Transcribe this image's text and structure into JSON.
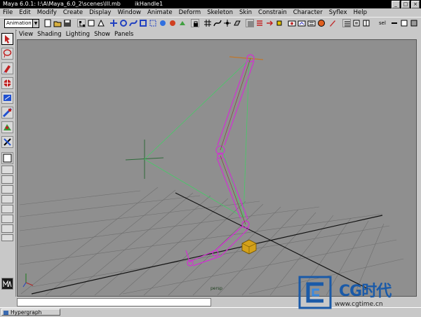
{
  "window": {
    "title": "Maya 6.0.1: I:\\A\\Maya_6.0_2\\scenes\\lll.mb",
    "title_object": "ikHandle1",
    "buttons": [
      "_",
      "□",
      "×"
    ]
  },
  "menus": [
    "File",
    "Edit",
    "Modify",
    "Create",
    "Display",
    "Window",
    "Animate",
    "Deform",
    "Skeleton",
    "Skin",
    "Constrain",
    "Character",
    "Syflex",
    "Help"
  ],
  "status_line": {
    "mode": "Animation",
    "select_label": "sel"
  },
  "panel_menus": [
    "View",
    "Shading",
    "Lighting",
    "Show",
    "Panels"
  ],
  "viewport": {
    "camera": "persp",
    "colors": {
      "background": "#8f8f8f",
      "grid": "#6e6e6e",
      "axis": "#111111",
      "bone": "#d22fd2",
      "ik": "#44cc66",
      "handle": "#d4a11a"
    }
  },
  "taskbar": {
    "item": "Hypergraph"
  },
  "watermark": {
    "brand": "CG时代",
    "url": "www.cgtime.cn"
  }
}
